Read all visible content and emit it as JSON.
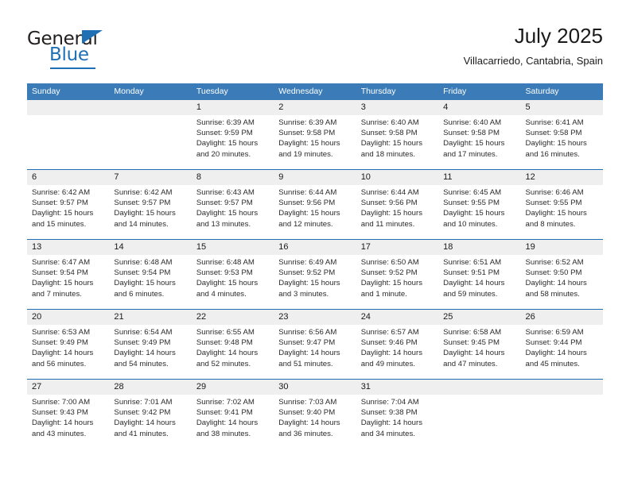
{
  "brand": {
    "name_top": "General",
    "name_bottom": "Blue",
    "accent_color": "#1f6fb5"
  },
  "header": {
    "title": "July 2025",
    "location": "Villacarriedo, Cantabria, Spain"
  },
  "calendar": {
    "header_bg": "#3b7cb8",
    "daynum_bg": "#efefef",
    "separator_color": "#1f6fb5",
    "weekdays": [
      "Sunday",
      "Monday",
      "Tuesday",
      "Wednesday",
      "Thursday",
      "Friday",
      "Saturday"
    ],
    "weeks": [
      [
        {
          "day": "",
          "lines": []
        },
        {
          "day": "",
          "lines": []
        },
        {
          "day": "1",
          "lines": [
            "Sunrise: 6:39 AM",
            "Sunset: 9:59 PM",
            "Daylight: 15 hours",
            "and 20 minutes."
          ]
        },
        {
          "day": "2",
          "lines": [
            "Sunrise: 6:39 AM",
            "Sunset: 9:58 PM",
            "Daylight: 15 hours",
            "and 19 minutes."
          ]
        },
        {
          "day": "3",
          "lines": [
            "Sunrise: 6:40 AM",
            "Sunset: 9:58 PM",
            "Daylight: 15 hours",
            "and 18 minutes."
          ]
        },
        {
          "day": "4",
          "lines": [
            "Sunrise: 6:40 AM",
            "Sunset: 9:58 PM",
            "Daylight: 15 hours",
            "and 17 minutes."
          ]
        },
        {
          "day": "5",
          "lines": [
            "Sunrise: 6:41 AM",
            "Sunset: 9:58 PM",
            "Daylight: 15 hours",
            "and 16 minutes."
          ]
        }
      ],
      [
        {
          "day": "6",
          "lines": [
            "Sunrise: 6:42 AM",
            "Sunset: 9:57 PM",
            "Daylight: 15 hours",
            "and 15 minutes."
          ]
        },
        {
          "day": "7",
          "lines": [
            "Sunrise: 6:42 AM",
            "Sunset: 9:57 PM",
            "Daylight: 15 hours",
            "and 14 minutes."
          ]
        },
        {
          "day": "8",
          "lines": [
            "Sunrise: 6:43 AM",
            "Sunset: 9:57 PM",
            "Daylight: 15 hours",
            "and 13 minutes."
          ]
        },
        {
          "day": "9",
          "lines": [
            "Sunrise: 6:44 AM",
            "Sunset: 9:56 PM",
            "Daylight: 15 hours",
            "and 12 minutes."
          ]
        },
        {
          "day": "10",
          "lines": [
            "Sunrise: 6:44 AM",
            "Sunset: 9:56 PM",
            "Daylight: 15 hours",
            "and 11 minutes."
          ]
        },
        {
          "day": "11",
          "lines": [
            "Sunrise: 6:45 AM",
            "Sunset: 9:55 PM",
            "Daylight: 15 hours",
            "and 10 minutes."
          ]
        },
        {
          "day": "12",
          "lines": [
            "Sunrise: 6:46 AM",
            "Sunset: 9:55 PM",
            "Daylight: 15 hours",
            "and 8 minutes."
          ]
        }
      ],
      [
        {
          "day": "13",
          "lines": [
            "Sunrise: 6:47 AM",
            "Sunset: 9:54 PM",
            "Daylight: 15 hours",
            "and 7 minutes."
          ]
        },
        {
          "day": "14",
          "lines": [
            "Sunrise: 6:48 AM",
            "Sunset: 9:54 PM",
            "Daylight: 15 hours",
            "and 6 minutes."
          ]
        },
        {
          "day": "15",
          "lines": [
            "Sunrise: 6:48 AM",
            "Sunset: 9:53 PM",
            "Daylight: 15 hours",
            "and 4 minutes."
          ]
        },
        {
          "day": "16",
          "lines": [
            "Sunrise: 6:49 AM",
            "Sunset: 9:52 PM",
            "Daylight: 15 hours",
            "and 3 minutes."
          ]
        },
        {
          "day": "17",
          "lines": [
            "Sunrise: 6:50 AM",
            "Sunset: 9:52 PM",
            "Daylight: 15 hours",
            "and 1 minute."
          ]
        },
        {
          "day": "18",
          "lines": [
            "Sunrise: 6:51 AM",
            "Sunset: 9:51 PM",
            "Daylight: 14 hours",
            "and 59 minutes."
          ]
        },
        {
          "day": "19",
          "lines": [
            "Sunrise: 6:52 AM",
            "Sunset: 9:50 PM",
            "Daylight: 14 hours",
            "and 58 minutes."
          ]
        }
      ],
      [
        {
          "day": "20",
          "lines": [
            "Sunrise: 6:53 AM",
            "Sunset: 9:49 PM",
            "Daylight: 14 hours",
            "and 56 minutes."
          ]
        },
        {
          "day": "21",
          "lines": [
            "Sunrise: 6:54 AM",
            "Sunset: 9:49 PM",
            "Daylight: 14 hours",
            "and 54 minutes."
          ]
        },
        {
          "day": "22",
          "lines": [
            "Sunrise: 6:55 AM",
            "Sunset: 9:48 PM",
            "Daylight: 14 hours",
            "and 52 minutes."
          ]
        },
        {
          "day": "23",
          "lines": [
            "Sunrise: 6:56 AM",
            "Sunset: 9:47 PM",
            "Daylight: 14 hours",
            "and 51 minutes."
          ]
        },
        {
          "day": "24",
          "lines": [
            "Sunrise: 6:57 AM",
            "Sunset: 9:46 PM",
            "Daylight: 14 hours",
            "and 49 minutes."
          ]
        },
        {
          "day": "25",
          "lines": [
            "Sunrise: 6:58 AM",
            "Sunset: 9:45 PM",
            "Daylight: 14 hours",
            "and 47 minutes."
          ]
        },
        {
          "day": "26",
          "lines": [
            "Sunrise: 6:59 AM",
            "Sunset: 9:44 PM",
            "Daylight: 14 hours",
            "and 45 minutes."
          ]
        }
      ],
      [
        {
          "day": "27",
          "lines": [
            "Sunrise: 7:00 AM",
            "Sunset: 9:43 PM",
            "Daylight: 14 hours",
            "and 43 minutes."
          ]
        },
        {
          "day": "28",
          "lines": [
            "Sunrise: 7:01 AM",
            "Sunset: 9:42 PM",
            "Daylight: 14 hours",
            "and 41 minutes."
          ]
        },
        {
          "day": "29",
          "lines": [
            "Sunrise: 7:02 AM",
            "Sunset: 9:41 PM",
            "Daylight: 14 hours",
            "and 38 minutes."
          ]
        },
        {
          "day": "30",
          "lines": [
            "Sunrise: 7:03 AM",
            "Sunset: 9:40 PM",
            "Daylight: 14 hours",
            "and 36 minutes."
          ]
        },
        {
          "day": "31",
          "lines": [
            "Sunrise: 7:04 AM",
            "Sunset: 9:38 PM",
            "Daylight: 14 hours",
            "and 34 minutes."
          ]
        },
        {
          "day": "",
          "lines": []
        },
        {
          "day": "",
          "lines": []
        }
      ]
    ]
  }
}
